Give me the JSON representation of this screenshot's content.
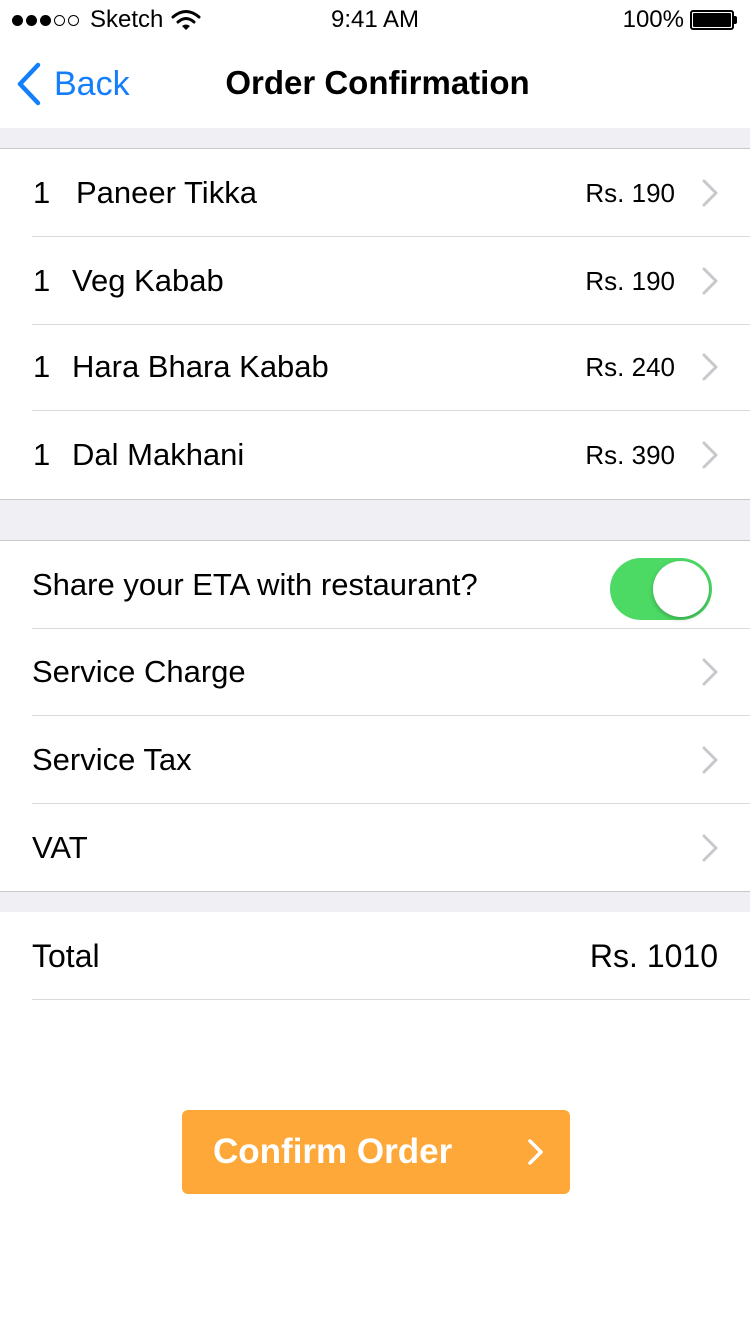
{
  "status_bar": {
    "signal_filled": 3,
    "signal_total": 5,
    "carrier": "Sketch",
    "time": "9:41 AM",
    "battery_percent": "100%"
  },
  "nav": {
    "back_label": "Back",
    "title": "Order Confirmation"
  },
  "order_items": [
    {
      "qty": "1",
      "name": "Paneer Tikka",
      "price": "Rs. 190"
    },
    {
      "qty": "1",
      "name": "Veg Kabab",
      "price": "Rs. 190"
    },
    {
      "qty": "1",
      "name": "Hara Bhara Kabab",
      "price": "Rs. 240"
    },
    {
      "qty": "1",
      "name": "Dal Makhani",
      "price": "Rs. 390"
    }
  ],
  "options": {
    "share_eta_label": "Share your ETA with restaurant?",
    "share_eta_enabled": true,
    "service_charge_label": "Service Charge",
    "service_tax_label": "Service Tax",
    "vat_label": "VAT"
  },
  "total": {
    "label": "Total",
    "value": "Rs. 1010"
  },
  "confirm_button": {
    "label": "Confirm Order"
  },
  "colors": {
    "accent_blue": "#157efb",
    "toggle_green": "#4cd964",
    "button_orange": "#fea83a",
    "group_background": "#efeff4",
    "chevron_gray": "#c7c7cc"
  },
  "icons": [
    "wifi-icon",
    "battery-icon",
    "back-chevron-icon",
    "chevron-right-icon"
  ]
}
